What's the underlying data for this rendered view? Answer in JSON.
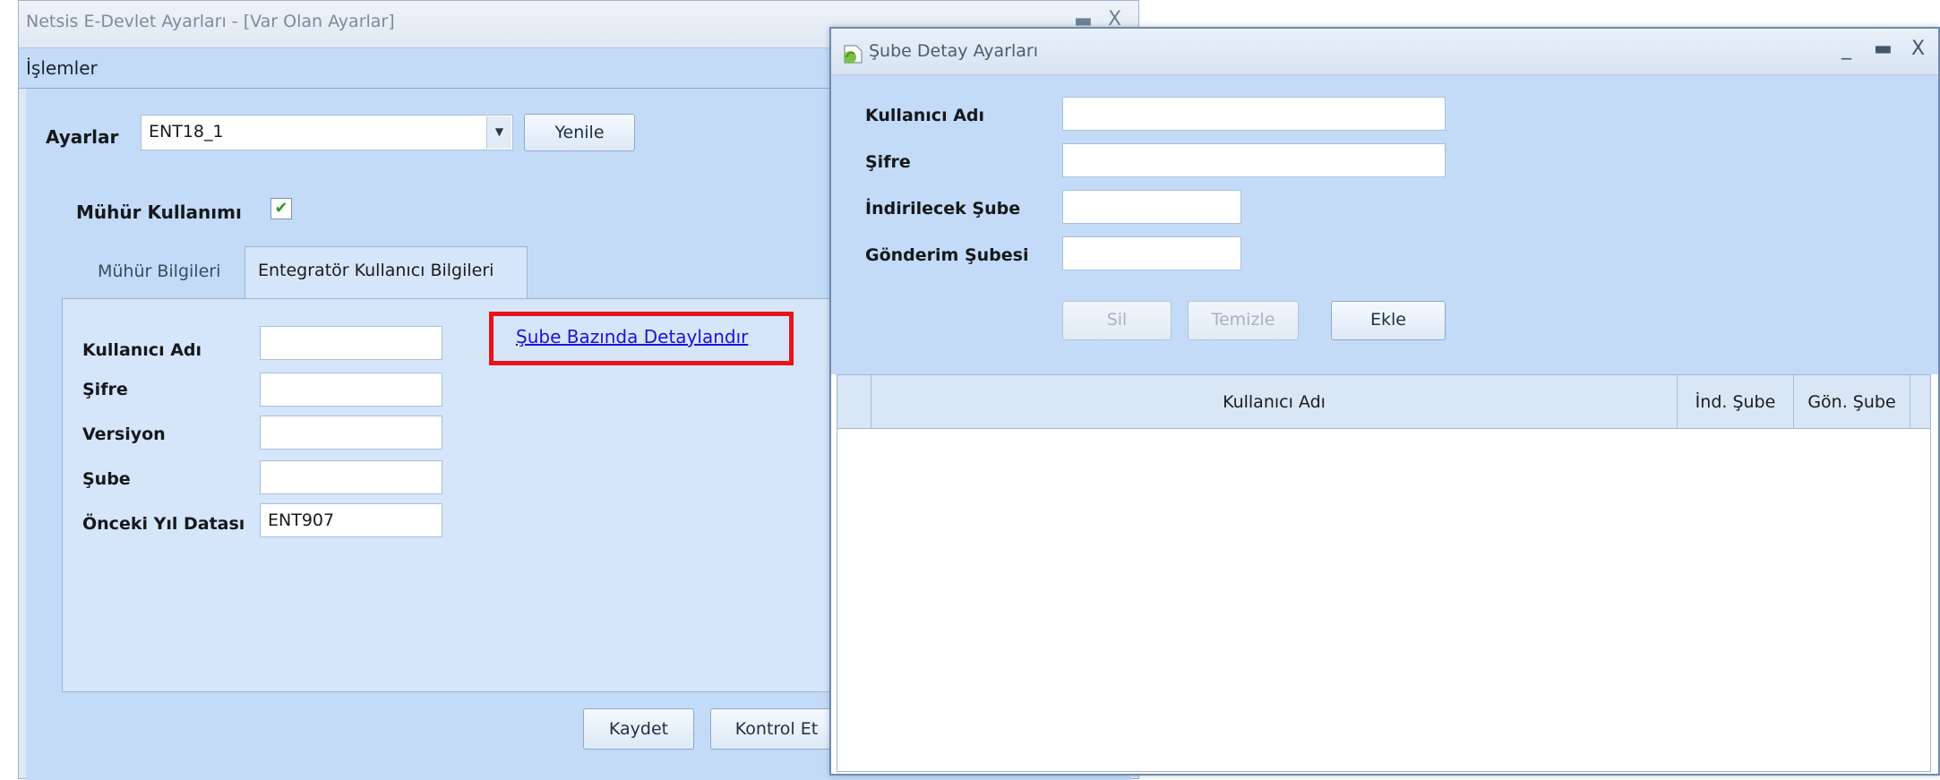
{
  "main_window": {
    "title": "Netsis E-Devlet Ayarları - [Var Olan Ayarlar]",
    "menu": {
      "islemler": "İşlemler"
    },
    "ayarlar_label": "Ayarlar",
    "ayarlar_value": "ENT18_1",
    "yenile_button": "Yenile",
    "muhur_kullanimi_label": "Mühür Kullanımı",
    "muhur_kullanimi_checked": true,
    "tabs": [
      {
        "label": "Mühür Bilgileri",
        "active": false
      },
      {
        "label": "Entegratör Kullanıcı Bilgileri",
        "active": true
      }
    ],
    "fields": {
      "kullanici_adi": {
        "label": "Kullanıcı Adı",
        "value": ""
      },
      "sifre": {
        "label": "Şifre",
        "value": ""
      },
      "versiyon": {
        "label": "Versiyon",
        "value": ""
      },
      "sube": {
        "label": "Şube",
        "value": ""
      },
      "onceki_yil": {
        "label": "Önceki Yıl Datası",
        "value": "ENT907"
      }
    },
    "sube_link": "Şube Bazında Detaylandır",
    "kaydet_button": "Kaydet",
    "kontrol_et_button": "Kontrol Et"
  },
  "detail_window": {
    "title": "Şube Detay Ayarları",
    "fields": {
      "kullanici_adi": {
        "label": "Kullanıcı Adı",
        "value": ""
      },
      "sifre": {
        "label": "Şifre",
        "value": ""
      },
      "indirilecek_sube": {
        "label": "İndirilecek Şube",
        "value": ""
      },
      "gonderim_subesi": {
        "label": "Gönderim Şubesi",
        "value": ""
      }
    },
    "buttons": {
      "sil": "Sil",
      "temizle": "Temizle",
      "ekle": "Ekle"
    },
    "grid_columns": [
      "Kullanıcı Adı",
      "İnd. Şube",
      "Gön. Şube"
    ]
  },
  "colors": {
    "highlight_red": "#e8141b",
    "link_blue": "#1a14d8",
    "window_blue": "#c3dbf7"
  }
}
